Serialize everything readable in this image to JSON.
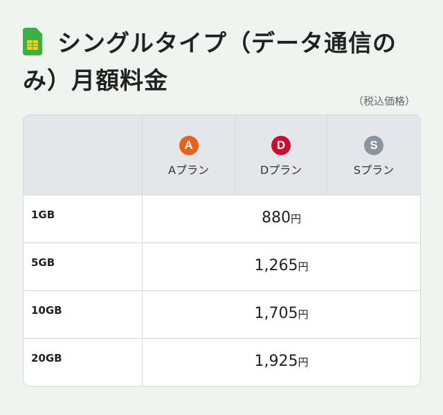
{
  "title": {
    "line1": "シングルタイプ（データ通信の",
    "line2": "み）月額料金"
  },
  "tax_note": "（税込価格）",
  "table": {
    "plans": [
      {
        "badge": "A",
        "name": "Aプラン",
        "color": "#e8601c"
      },
      {
        "badge": "D",
        "name": "Dプラン",
        "color": "#c8102e"
      },
      {
        "badge": "S",
        "name": "Sプラン",
        "color": "#8a93a0"
      }
    ],
    "rows": [
      {
        "label": "1GB",
        "price": "880",
        "unit": "円"
      },
      {
        "label": "5GB",
        "price": "1,265",
        "unit": "円"
      },
      {
        "label": "10GB",
        "price": "1,705",
        "unit": "円"
      },
      {
        "label": "20GB",
        "price": "1,925",
        "unit": "円"
      }
    ]
  },
  "colors": {
    "sim_icon": "#3cb043",
    "sim_chip": "#f5d020"
  }
}
